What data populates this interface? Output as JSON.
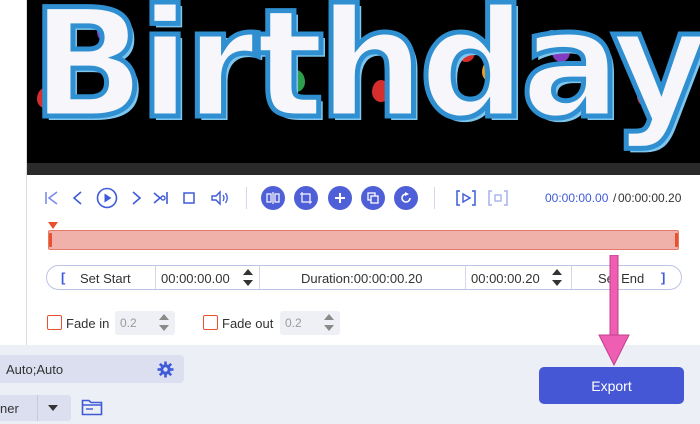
{
  "preview": {
    "overlay_text": "Birthday"
  },
  "controls": {
    "icons": [
      "skip-start-icon",
      "prev-frame-icon",
      "play-icon",
      "next-frame-icon",
      "skip-end-icon",
      "stop-icon",
      "volume-icon",
      "split-icon",
      "crop-icon",
      "add-segment-icon",
      "copy-icon",
      "reset-icon",
      "set-in-icon",
      "set-out-icon"
    ],
    "current_time": "00:00:00.00",
    "separator": "/",
    "total_time": "00:00:00.20"
  },
  "trim": {
    "open_bracket": "[",
    "set_start_label": "Set Start",
    "start_time": "00:00:00.00",
    "duration_text": "Duration:00:00:00.20",
    "end_time": "00:00:00.20",
    "set_end_label": "Set End",
    "close_bracket": "]"
  },
  "fade": {
    "fade_in_label": "Fade in",
    "fade_in_value": "0.2",
    "fade_out_label": "Fade out",
    "fade_out_value": "0.2"
  },
  "output": {
    "settings_value": "Auto;Auto",
    "save_to_value": "ner"
  },
  "export_label": "Export",
  "colors": {
    "accent": "#4657d6",
    "timeline_fill": "#efb1a9",
    "marker": "#e8512e",
    "arrow": "#ee5fb4"
  }
}
